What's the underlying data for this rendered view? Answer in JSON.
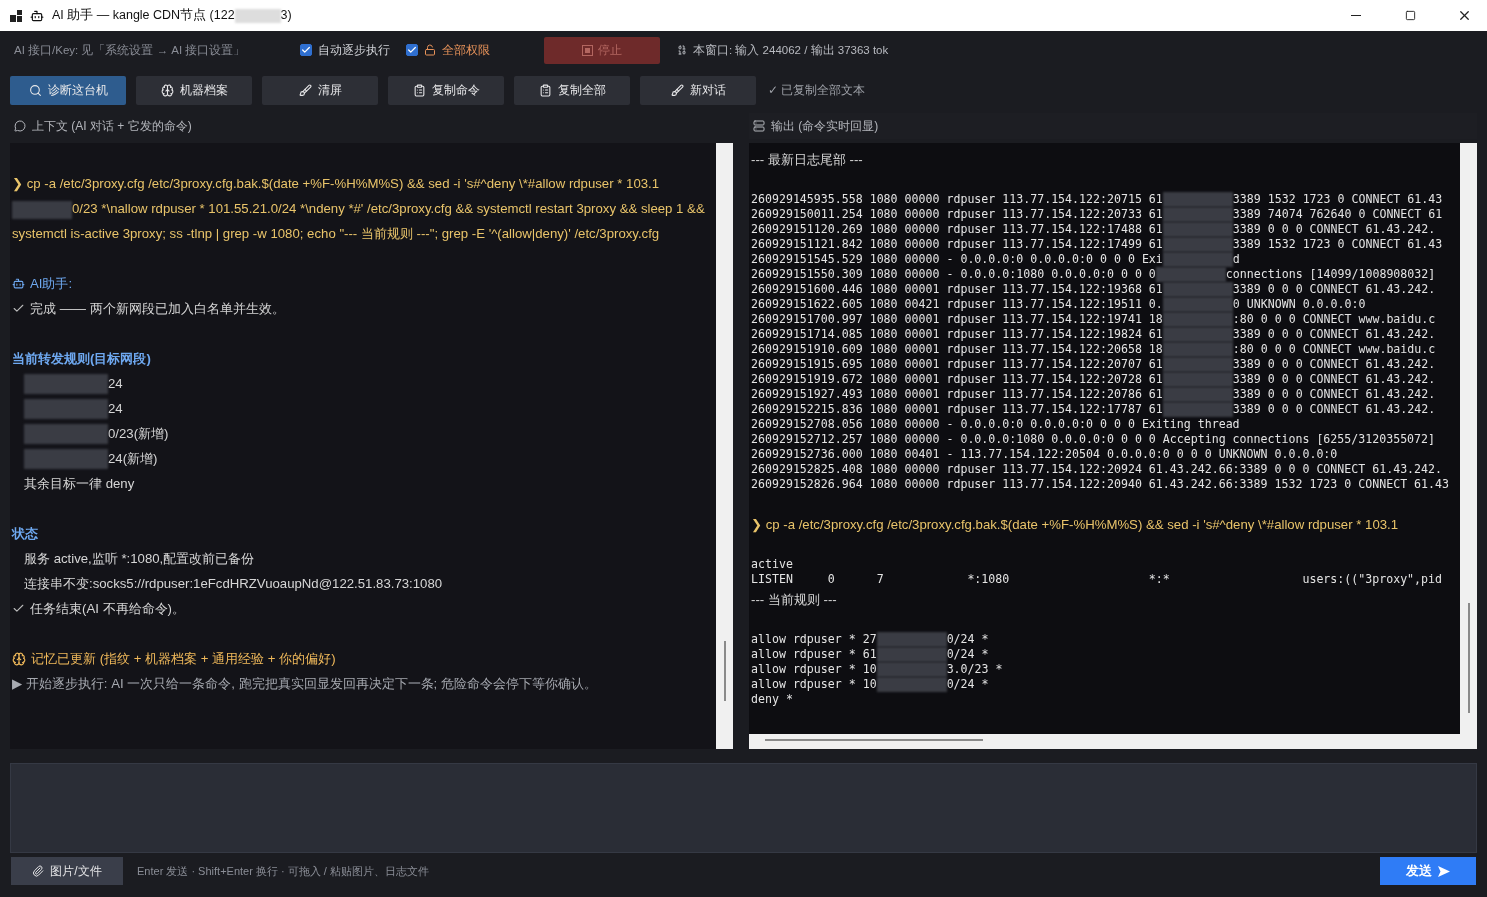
{
  "window": {
    "title": [
      {
        "text": "AI 助手 — kangle CDN节点 (122"
      },
      {
        "kind": "redacted"
      },
      {
        "text": "3)"
      }
    ]
  },
  "topbar": {
    "api_note": "AI 接口/Key: 见「系统设置 → AI 接口设置」",
    "options": [
      {
        "label": "自动逐步执行",
        "checked": true,
        "kind": "plain"
      },
      {
        "label": "全部权限",
        "checked": true,
        "kind": "unlock"
      }
    ],
    "stop_button": {
      "label": "停止",
      "disabled": true
    },
    "usage": "本窗口: 输入 244062 / 输出 37363 tok"
  },
  "toolbar": {
    "buttons": [
      {
        "label": "诊断这台机",
        "selected": true
      },
      {
        "label": "机器档案",
        "selected": false
      },
      {
        "label": "清屏",
        "selected": false
      },
      {
        "label": "复制命令",
        "selected": false
      },
      {
        "label": "复制全部",
        "selected": false
      },
      {
        "label": "新对话",
        "selected": false
      }
    ],
    "status": "✓ 已复制全部文本"
  },
  "context_panel": {
    "title": "上下文 (AI 对话 + 它发的命令)",
    "blocks": [
      {
        "lines": [
          {
            "kind": "command",
            "segments": [
              {
                "text": "❯ cp -a /etc/3proxy.cfg /etc/3proxy.cfg.bak.$(date +%F-%H%M%S) && sed -i 's#^deny \\*#allow rdpuser * 103.1"
              },
              {
                "kind": "redacted"
              },
              {
                "text": "0/23 *\\nallow rdpuser * 101.55.21.0/24 *\\ndeny *#' /etc/3proxy.cfg && systemctl restart 3proxy && sleep 1 && systemctl is-active 3proxy; ss -tlnp | grep -w 1080; echo \"--- 当前规则 ---\"; grep -E '^(allow|deny)' /etc/3proxy.cfg"
              }
            ]
          }
        ]
      },
      {
        "lines": [
          {
            "kind": "speaker",
            "segments": [
              {
                "text": "AI助手:"
              }
            ]
          },
          {
            "kind": "done",
            "segments": [
              {
                "text": "完成 —— 两个新网段已加入白名单并生效。"
              }
            ]
          }
        ]
      },
      {
        "lines": [
          {
            "kind": "heading",
            "segments": [
              {
                "text": "当前转发规则(目标网段)"
              }
            ]
          },
          {
            "kind": "item",
            "segments": [
              {
                "kind": "redacted"
              },
              {
                "text": "24"
              }
            ]
          },
          {
            "kind": "item",
            "segments": [
              {
                "kind": "redacted"
              },
              {
                "text": "24"
              }
            ]
          },
          {
            "kind": "item",
            "segments": [
              {
                "kind": "redacted"
              },
              {
                "text": "0/23(新增)"
              }
            ]
          },
          {
            "kind": "item",
            "segments": [
              {
                "kind": "redacted"
              },
              {
                "text": "24(新增)"
              }
            ]
          },
          {
            "kind": "item",
            "segments": [
              {
                "text": "其余目标一律 deny"
              }
            ]
          }
        ]
      },
      {
        "lines": [
          {
            "kind": "heading",
            "segments": [
              {
                "text": "状态"
              }
            ]
          },
          {
            "kind": "item",
            "segments": [
              {
                "text": "服务 active,监听 *:1080,配置改前已备份"
              }
            ]
          },
          {
            "kind": "item",
            "segments": [
              {
                "text": "连接串不变:socks5://rdpuser:1eFcdHRZVuoaupNd@122.51.83.73:1080"
              }
            ]
          },
          {
            "kind": "done",
            "segments": [
              {
                "text": "任务结束(AI 不再给命令)。"
              }
            ]
          }
        ]
      },
      {
        "lines": [
          {
            "kind": "memory",
            "segments": [
              {
                "text": "记忆已更新 (指纹 + 机器档案 + 通用经验 + 你的偏好)"
              }
            ]
          },
          {
            "kind": "note",
            "segments": [
              {
                "text": "▶ 开始逐步执行: AI 一次只给一条命令, 跑完把真实回显发回再决定下一条; 危险命令会停下等你确认。"
              }
            ]
          }
        ]
      }
    ]
  },
  "output_panel": {
    "title": "输出 (命令实时回显)",
    "blocks": [
      {
        "lines": [
          {
            "kind": "banner",
            "segments": [
              {
                "text": "--- 最新日志尾部 ---"
              }
            ]
          }
        ]
      },
      {
        "lines": [
          {
            "kind": "log",
            "segments": [
              {
                "text": "260929145935.558 1080 00000 rdpuser 113.77.154.122:20715 61"
              },
              {
                "kind": "redacted"
              },
              {
                "text": "3389 1532 1723 0 CONNECT 61.43"
              }
            ]
          },
          {
            "kind": "log",
            "segments": [
              {
                "text": "260929150011.254 1080 00000 rdpuser 113.77.154.122:20733 61"
              },
              {
                "kind": "redacted"
              },
              {
                "text": "3389 74074 762640 0 CONNECT 61"
              }
            ]
          },
          {
            "kind": "log",
            "segments": [
              {
                "text": "260929151120.269 1080 00000 rdpuser 113.77.154.122:17488 61"
              },
              {
                "kind": "redacted"
              },
              {
                "text": "3389 0 0 0 CONNECT 61.43.242."
              }
            ]
          },
          {
            "kind": "log",
            "segments": [
              {
                "text": "260929151121.842 1080 00000 rdpuser 113.77.154.122:17499 61"
              },
              {
                "kind": "redacted"
              },
              {
                "text": "3389 1532 1723 0 CONNECT 61.43"
              }
            ]
          },
          {
            "kind": "log",
            "segments": [
              {
                "text": "260929151545.529 1080 00000 - 0.0.0.0:0 0.0.0.0:0 0 0 0 Exi"
              },
              {
                "kind": "redacted"
              },
              {
                "text": "d"
              }
            ]
          },
          {
            "kind": "log",
            "segments": [
              {
                "text": "260929151550.309 1080 00000 - 0.0.0.0:1080 0.0.0.0:0 0 0 0"
              },
              {
                "kind": "redacted"
              },
              {
                "text": "connections [14099/1008908032]"
              }
            ]
          },
          {
            "kind": "log",
            "segments": [
              {
                "text": "260929151600.446 1080 00001 rdpuser 113.77.154.122:19368 61"
              },
              {
                "kind": "redacted"
              },
              {
                "text": "3389 0 0 0 CONNECT 61.43.242."
              }
            ]
          },
          {
            "kind": "log",
            "segments": [
              {
                "text": "260929151622.605 1080 00421 rdpuser 113.77.154.122:19511 0."
              },
              {
                "kind": "redacted"
              },
              {
                "text": "0 UNKNOWN 0.0.0.0:0"
              }
            ]
          },
          {
            "kind": "log",
            "segments": [
              {
                "text": "260929151700.997 1080 00001 rdpuser 113.77.154.122:19741 18"
              },
              {
                "kind": "redacted"
              },
              {
                "text": ":80 0 0 0 CONNECT www.baidu.c"
              }
            ]
          },
          {
            "kind": "log",
            "segments": [
              {
                "text": "260929151714.085 1080 00001 rdpuser 113.77.154.122:19824 61"
              },
              {
                "kind": "redacted"
              },
              {
                "text": "3389 0 0 0 CONNECT 61.43.242."
              }
            ]
          },
          {
            "kind": "log",
            "segments": [
              {
                "text": "260929151910.609 1080 00001 rdpuser 113.77.154.122:20658 18"
              },
              {
                "kind": "redacted"
              },
              {
                "text": ":80 0 0 0 CONNECT www.baidu.c"
              }
            ]
          },
          {
            "kind": "log",
            "segments": [
              {
                "text": "260929151915.695 1080 00001 rdpuser 113.77.154.122:20707 61"
              },
              {
                "kind": "redacted"
              },
              {
                "text": "3389 0 0 0 CONNECT 61.43.242."
              }
            ]
          },
          {
            "kind": "log",
            "segments": [
              {
                "text": "260929151919.672 1080 00001 rdpuser 113.77.154.122:20728 61"
              },
              {
                "kind": "redacted"
              },
              {
                "text": "3389 0 0 0 CONNECT 61.43.242."
              }
            ]
          },
          {
            "kind": "log",
            "segments": [
              {
                "text": "260929151927.493 1080 00001 rdpuser 113.77.154.122:20786 61"
              },
              {
                "kind": "redacted"
              },
              {
                "text": "3389 0 0 0 CONNECT 61.43.242."
              }
            ]
          },
          {
            "kind": "log",
            "segments": [
              {
                "text": "260929152215.836 1080 00001 rdpuser 113.77.154.122:17787 61"
              },
              {
                "kind": "redacted"
              },
              {
                "text": "3389 0 0 0 CONNECT 61.43.242."
              }
            ]
          },
          {
            "kind": "log",
            "segments": [
              {
                "text": "260929152708.056 1080 00000 - 0.0.0.0:0 0.0.0.0:0 0 0 0 Exiting thread"
              }
            ]
          },
          {
            "kind": "log",
            "segments": [
              {
                "text": "260929152712.257 1080 00000 - 0.0.0.0:1080 0.0.0.0:0 0 0 0 Accepting connections [6255/3120355072]"
              }
            ]
          },
          {
            "kind": "log",
            "segments": [
              {
                "text": "260929152736.000 1080 00401 - 113.77.154.122:20504 0.0.0.0:0 0 0 0 UNKNOWN 0.0.0.0:0"
              }
            ]
          },
          {
            "kind": "log",
            "segments": [
              {
                "text": "260929152825.408 1080 00000 rdpuser 113.77.154.122:20924 61.43.242.66:3389 0 0 0 CONNECT 61.43.242."
              }
            ]
          },
          {
            "kind": "log",
            "segments": [
              {
                "text": "260929152826.964 1080 00000 rdpuser 113.77.154.122:20940 61.43.242.66:3389 1532 1723 0 CONNECT 61.43"
              }
            ]
          }
        ]
      },
      {
        "lines": [
          {
            "kind": "command",
            "segments": [
              {
                "text": "❯ cp -a /etc/3proxy.cfg /etc/3proxy.cfg.bak.$(date +%F-%H%M%S) && sed -i 's#^deny \\*#allow rdpuser * 103.1"
              }
            ]
          }
        ]
      },
      {
        "lines": [
          {
            "kind": "log",
            "segments": [
              {
                "text": "active"
              }
            ]
          },
          {
            "kind": "log",
            "segments": [
              {
                "text": "LISTEN     0      7            *:1080                    *:*                   users:((\"3proxy\",pid"
              }
            ]
          },
          {
            "kind": "banner",
            "segments": [
              {
                "text": "--- 当前规则 ---"
              }
            ]
          }
        ]
      },
      {
        "lines": [
          {
            "kind": "log",
            "segments": [
              {
                "text": "allow rdpuser * 27"
              },
              {
                "kind": "redacted"
              },
              {
                "text": "0/24 *"
              }
            ]
          },
          {
            "kind": "log",
            "segments": [
              {
                "text": "allow rdpuser * 61"
              },
              {
                "kind": "redacted"
              },
              {
                "text": "0/24 *"
              }
            ]
          },
          {
            "kind": "log",
            "segments": [
              {
                "text": "allow rdpuser * 10"
              },
              {
                "kind": "redacted"
              },
              {
                "text": "3.0/23 *"
              }
            ]
          },
          {
            "kind": "log",
            "segments": [
              {
                "text": "allow rdpuser * 10"
              },
              {
                "kind": "redacted"
              },
              {
                "text": "0/24 *"
              }
            ]
          },
          {
            "kind": "log",
            "segments": [
              {
                "text": "deny *"
              }
            ]
          }
        ]
      }
    ]
  },
  "composer": {
    "attach_button": "图片/文件",
    "hint": "Enter 发送 · Shift+Enter 换行 · 可拖入 / 粘贴图片、日志文件",
    "send_button": "发送"
  }
}
